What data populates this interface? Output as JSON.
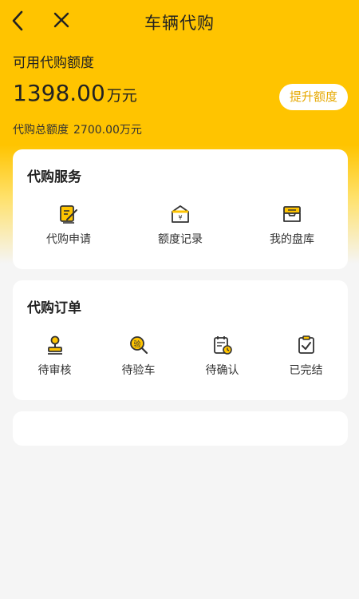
{
  "header": {
    "title": "车辆代购",
    "back_icon": "back-arrow-icon",
    "close_icon": "close-icon"
  },
  "quota": {
    "available_label": "可用代购额度",
    "available_amount": "1398.00",
    "available_unit": "万元",
    "raise_button": "提升额度",
    "total_label": "代购总额度",
    "total_value": "2700.00万元"
  },
  "services": {
    "title": "代购服务",
    "items": [
      {
        "label": "代购申请",
        "icon": "edit-form-icon"
      },
      {
        "label": "额度记录",
        "icon": "envelope-money-icon"
      },
      {
        "label": "我的盘库",
        "icon": "inbox-tray-icon"
      }
    ]
  },
  "orders": {
    "title": "代购订单",
    "items": [
      {
        "label": "待审核",
        "icon": "stamp-icon"
      },
      {
        "label": "待验车",
        "icon": "inspect-search-icon",
        "icon_text": "验"
      },
      {
        "label": "待确认",
        "icon": "calendar-clock-icon"
      },
      {
        "label": "已完结",
        "icon": "clipboard-check-icon"
      }
    ]
  },
  "colors": {
    "accent": "#ffc400",
    "accent_text": "#e6a800",
    "icon_stroke": "#333333"
  }
}
